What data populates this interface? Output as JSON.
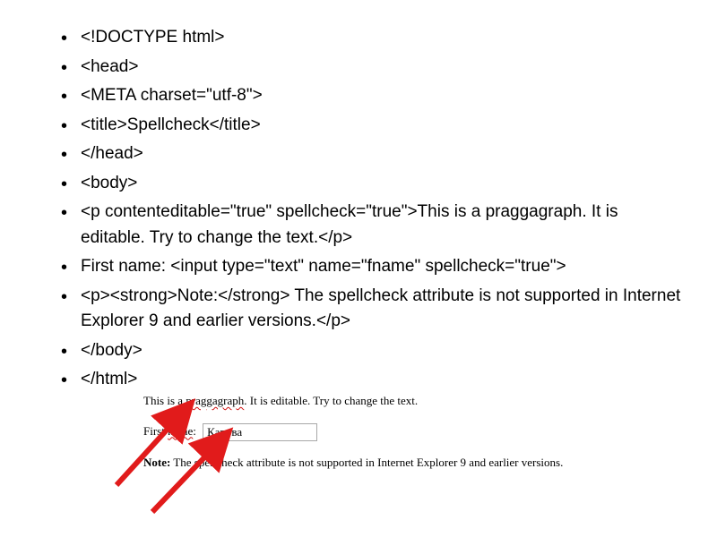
{
  "code": {
    "l1": "<!DOCTYPE html>",
    "l2": "<head>",
    "l3": "<META charset=\"utf-8\">",
    "l4": "<title>Spellcheck</title>",
    "l5": "</head>",
    "l6": "<body>",
    "l7": "<p contenteditable=\"true\" spellcheck=\"true\">This is a praggagraph. It is editable. Try to change the text.</p>",
    "l8": "First name: <input type=\"text\" name=\"fname\" spellcheck=\"true\">",
    "l9": "<p><strong>Note:</strong> The spellcheck attribute is not supported in Internet Explorer 9 and earlier versions.</p>",
    "l10": "</body>",
    "l11": "</html>"
  },
  "render": {
    "para1": {
      "part1": "This is a ",
      "word1": "praggagraph",
      "part2": ". It is editable. Try to change the text."
    },
    "form": {
      "label_part1": "First ",
      "label_word": "name",
      "label_part2": ": ",
      "input_value": "Карова"
    },
    "note": {
      "strong": "Note:",
      "rest": " The spellcheck attribute is not supported in Internet Explorer 9 and earlier versions."
    }
  }
}
